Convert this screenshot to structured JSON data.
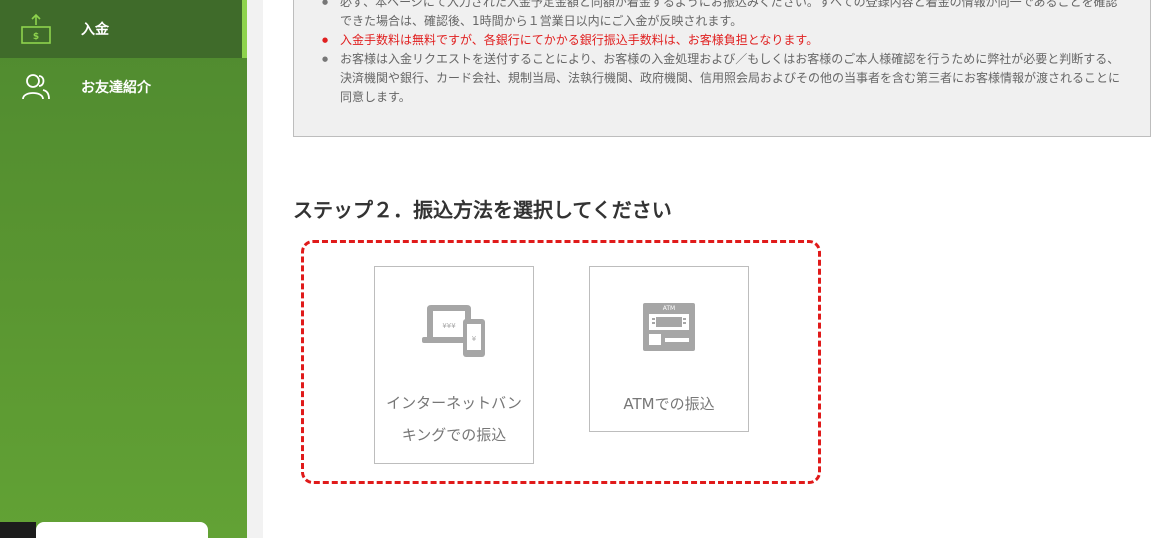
{
  "sidebar": {
    "items": [
      {
        "label": "入金",
        "icon": "deposit-icon",
        "active": true
      },
      {
        "label": "お友達紹介",
        "icon": "users-icon",
        "active": false
      }
    ]
  },
  "notice": {
    "items": [
      {
        "text": "必ず、本ページにて入力された入金予定金額と同額が着金するようにお振込みください。すべての登録内容と着金の情報が同一であることを確認できた場合は、確認後、1時間から１営業日以内にご入金が反映されます。",
        "highlight": false
      },
      {
        "text": "入金手数料は無料ですが、各銀行にてかかる銀行振込手数料は、お客様負担となります。",
        "highlight": true
      },
      {
        "text": "お客様は入金リクエストを送付することにより、お客様の入金処理および／もしくはお客様のご本人様確認を行うために弊社が必要と判断する、決済機関や銀行、カード会社、規制当局、法執行機関、政府機関、信用照会局およびその他の当事者を含む第三者にお客様情報が渡されることに同意します。",
        "highlight": false
      }
    ]
  },
  "step2": {
    "title": "ステップ２．振込方法を選択してください"
  },
  "methods": {
    "internet": {
      "label_line1": "インターネットバン",
      "label_line2": "キングでの振込",
      "icon": "online-banking-icon",
      "icon_text": "¥¥¥",
      "icon_text2": "¥"
    },
    "atm": {
      "label": "ATMでの振込",
      "icon": "atm-icon",
      "icon_text": "ATM"
    }
  },
  "colors": {
    "sidebar_green": "#5a9631",
    "sidebar_active": "#3f6b2a",
    "accent_lime": "#8ed34d",
    "alert_red": "#e02020",
    "icon_gray": "#a6a6a6"
  }
}
